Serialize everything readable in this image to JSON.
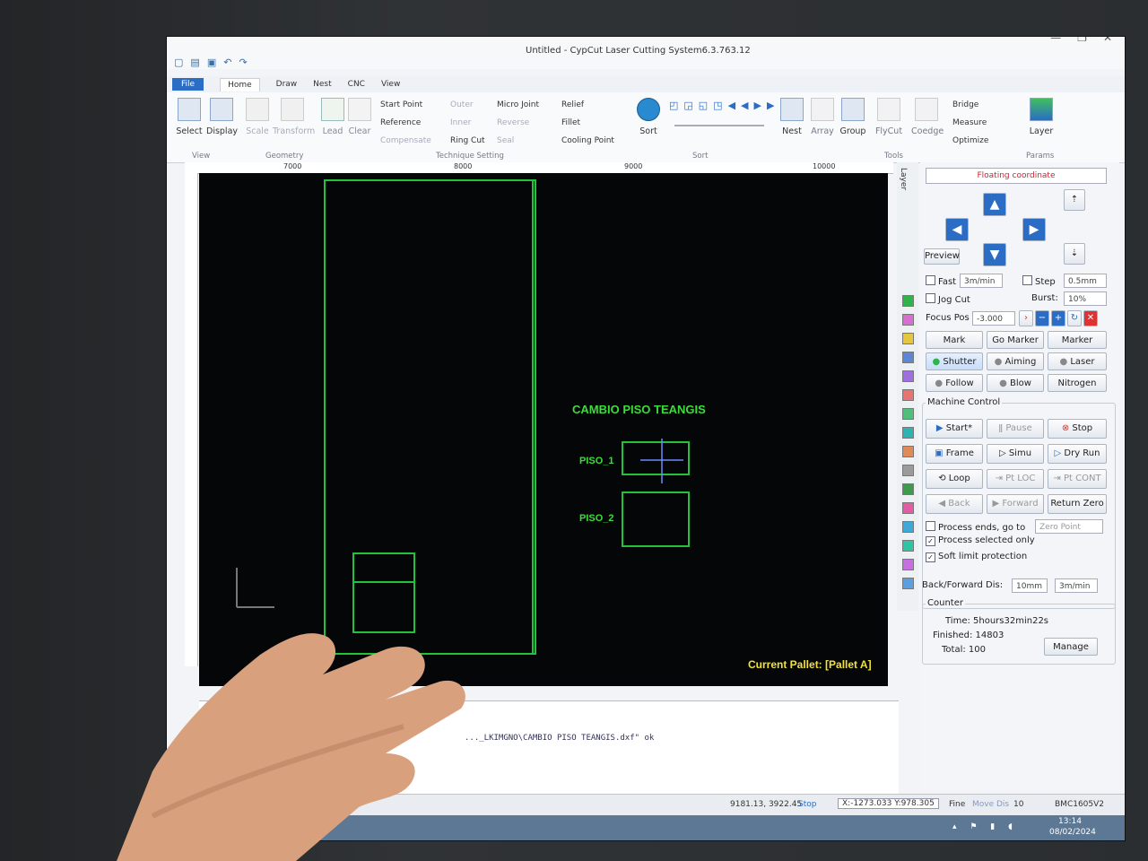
{
  "window": {
    "title": "Untitled - CypCut Laser Cutting System6.3.763.12",
    "controls": [
      "—",
      "❐",
      "✕"
    ]
  },
  "menu": {
    "file": "File",
    "tabs": [
      "Home",
      "Draw",
      "Nest",
      "CNC",
      "View"
    ]
  },
  "ribbon": {
    "view_group": {
      "select": "Select",
      "display": "Display",
      "caption": "View"
    },
    "geometry_group": {
      "scale": "Scale",
      "transform": "Transform",
      "caption": "Geometry"
    },
    "lead": "Lead",
    "clear": "Clear",
    "technique": {
      "start_point": "Start Point",
      "reference": "Reference",
      "compensate": "Compensate",
      "outer": "Outer",
      "inner": "Inner",
      "ring_cut": "Ring Cut",
      "micro_joint": "Micro Joint",
      "reverse": "Reverse",
      "seal": "Seal",
      "relief": "Relief",
      "fillet": "Fillet",
      "cooling_point": "Cooling Point",
      "caption": "Technique Setting"
    },
    "sort": {
      "label": "Sort",
      "caption": "Sort"
    },
    "tools": {
      "nest": "Nest",
      "array": "Array",
      "group": "Group",
      "flycut": "FlyCut",
      "coedge": "Coedge",
      "bridge": "Bridge",
      "measure": "Measure",
      "optimize": "Optimize",
      "caption": "Tools"
    },
    "params": {
      "layer": "Layer",
      "caption": "Params"
    }
  },
  "ruler": {
    "ticks": [
      "7000",
      "8000",
      "9000",
      "10000"
    ]
  },
  "canvas": {
    "title_text": "CAMBIO PISO TEANGIS",
    "part1": "PISO_1",
    "part2": "PISO_2",
    "pallet": "Current Pallet: [Pallet A]",
    "layer_label": "Layer"
  },
  "panel": {
    "coordinate_mode": "Floating coordinate",
    "preview": "Preview",
    "fast": "Fast",
    "fast_speed": "3m/min",
    "step": "Step",
    "step_value": "0.5mm",
    "jog_cut": "Jog Cut",
    "burst": "Burst:",
    "burst_value": "10%",
    "focus_pos": "Focus Pos",
    "focus_value": "-3.000",
    "mark": "Mark",
    "go_marker": "Go Marker",
    "marker": "Marker",
    "shutter": "Shutter",
    "aiming": "Aiming",
    "laser": "Laser",
    "follow": "Follow",
    "blow": "Blow",
    "nitrogen": "Nitrogen",
    "machine_control": "Machine Control",
    "start": "Start*",
    "pause": "Pause",
    "stop": "Stop",
    "frame": "Frame",
    "simu": "Simu",
    "dry_run": "Dry Run",
    "loop": "Loop",
    "pt_loc": "Pt LOC",
    "pt_cont": "Pt CONT",
    "back": "Back",
    "forward": "Forward",
    "return_zero": "Return Zero",
    "process_ends": "Process ends, go to",
    "zero_point": "Zero Point",
    "process_selected": "Process selected only",
    "soft_limit": "Soft limit protection",
    "back_forward_dis": "Back/Forward Dis:",
    "bf_distance": "10mm",
    "bf_speed": "3m/min",
    "counter": "Counter",
    "time": "Time: 5hours32min22s",
    "finished": "Finished: 14803",
    "total": "Total: 100",
    "manage": "Manage"
  },
  "console": {
    "log": "..._LKIMGNO\\CAMBIO PISO TEANGIS.dxf\" ok"
  },
  "status": {
    "coords": "9181.13, 3922.45",
    "state": "Stop",
    "position": "X:-1273.033 Y:978.305",
    "fine": "Fine",
    "move_dis": "Move Dis",
    "move_value": "10",
    "controller": "BMC1605V2"
  },
  "taskbar": {
    "time": "13:14",
    "date": "08/02/2024"
  },
  "colors": {
    "canvas": "#050607",
    "contour": "#22c23a",
    "text_green": "#3bdc3b",
    "pallet_text": "#f2e23a",
    "accent": "#2b6cc4"
  },
  "layer_colors": [
    "#2fb34a",
    "#d66fd0",
    "#e5c63f",
    "#5d86d6",
    "#9f6fe0",
    "#e97373",
    "#4fbf7a",
    "#2eb3b3",
    "#e08a5a",
    "#9b9b9b",
    "#3f9a4d",
    "#e45ca4",
    "#3ea8d6",
    "#2fc4a4",
    "#c56fe0",
    "#5aa0e0"
  ]
}
